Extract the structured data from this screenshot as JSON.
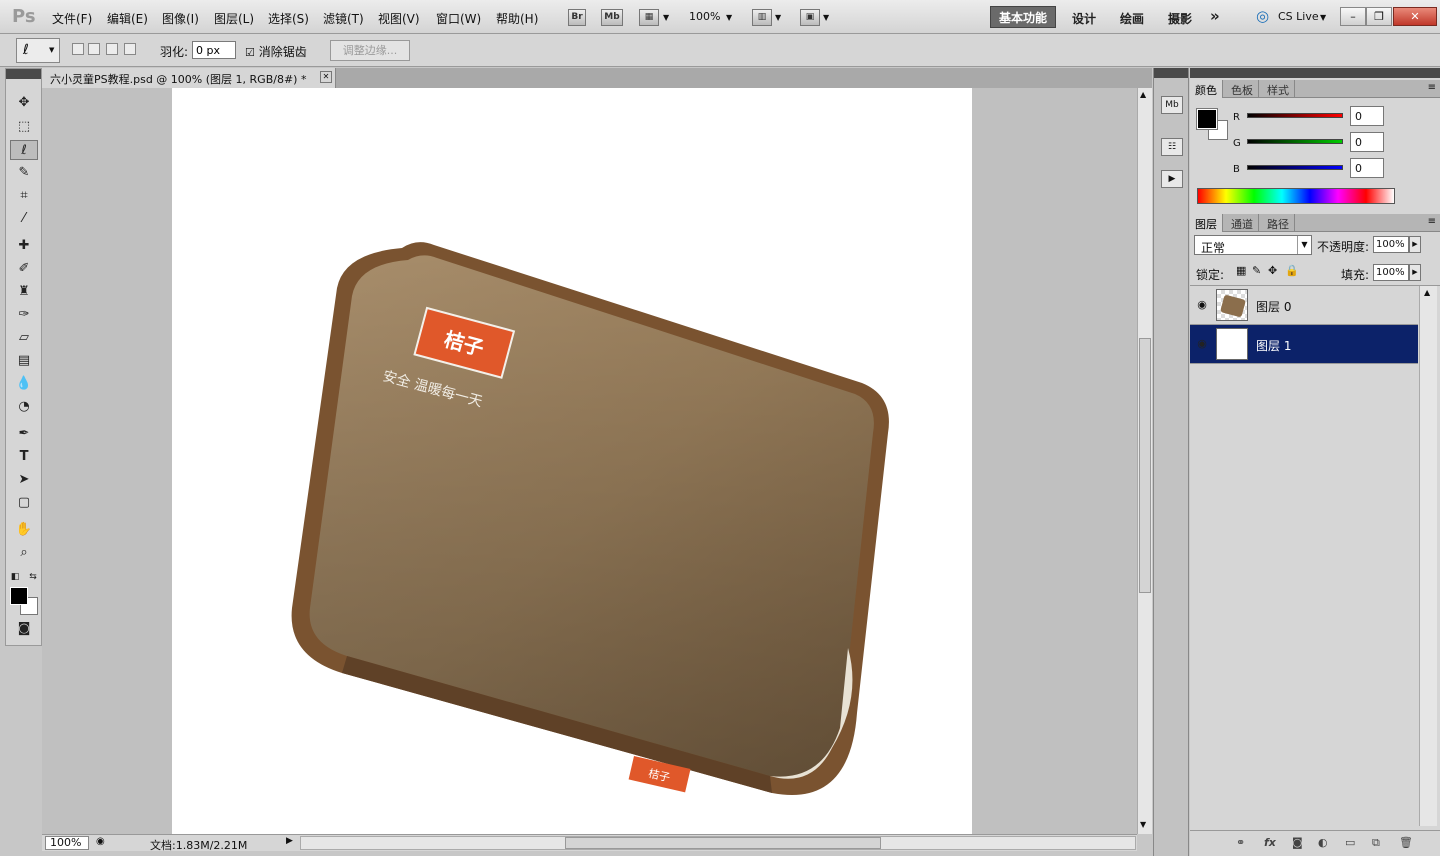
{
  "app": {
    "logo": "Ps"
  },
  "menu": {
    "items": [
      "文件(F)",
      "编辑(E)",
      "图像(I)",
      "图层(L)",
      "选择(S)",
      "滤镜(T)",
      "视图(V)",
      "窗口(W)",
      "帮助(H)"
    ],
    "br_label": "Br",
    "mb_label": "Mb",
    "zoom": "100%",
    "workspaces": {
      "active": "基本功能",
      "others": [
        "设计",
        "绘画",
        "摄影"
      ]
    },
    "expand": "»",
    "cs_live": "CS Live"
  },
  "window_controls": {
    "minimize": "–",
    "restore": "❐",
    "close": "✕"
  },
  "options": {
    "feather_label": "羽化:",
    "feather_value": "0 px",
    "antialias_label": "消除锯齿",
    "antialias_checked": true,
    "refine_edge_label": "调整边缘..."
  },
  "document": {
    "tab_title": "六小灵童PS教程.psd @ 100% (图层 1, RGB/8#) *",
    "close": "✕",
    "product": {
      "brand": "桔子",
      "slogan": "安全 温暖每一天",
      "tag": "桔子"
    }
  },
  "status": {
    "zoom": "100%",
    "doc_info": "文档:1.83M/2.21M"
  },
  "color_panel": {
    "tabs": [
      "颜色",
      "色板",
      "样式"
    ],
    "active_tab": "颜色",
    "sliders": [
      {
        "label": "R",
        "value": "0",
        "color": "#cc1111"
      },
      {
        "label": "G",
        "value": "0",
        "color": "#11aa22"
      },
      {
        "label": "B",
        "value": "0",
        "color": "#1111cc"
      }
    ]
  },
  "layers_panel": {
    "tabs": [
      "图层",
      "通道",
      "路径"
    ],
    "active_tab": "图层",
    "blend_mode": "正常",
    "opacity_label": "不透明度:",
    "opacity": "100%",
    "lock_label": "锁定:",
    "fill_label": "填充:",
    "fill": "100%",
    "layers": [
      {
        "name": "图层 0",
        "selected": false,
        "visible": true
      },
      {
        "name": "图层 1",
        "selected": true,
        "visible": true
      }
    ]
  },
  "tools": [
    "move-tool",
    "marquee-tool",
    "lasso-tool",
    "quick-select-tool",
    "crop-tool",
    "eyedropper-tool",
    "healing-brush-tool",
    "brush-tool",
    "clone-stamp-tool",
    "history-brush-tool",
    "eraser-tool",
    "gradient-tool",
    "blur-tool",
    "dodge-tool",
    "pen-tool",
    "type-tool",
    "path-select-tool",
    "shape-tool",
    "hand-tool",
    "zoom-tool"
  ]
}
